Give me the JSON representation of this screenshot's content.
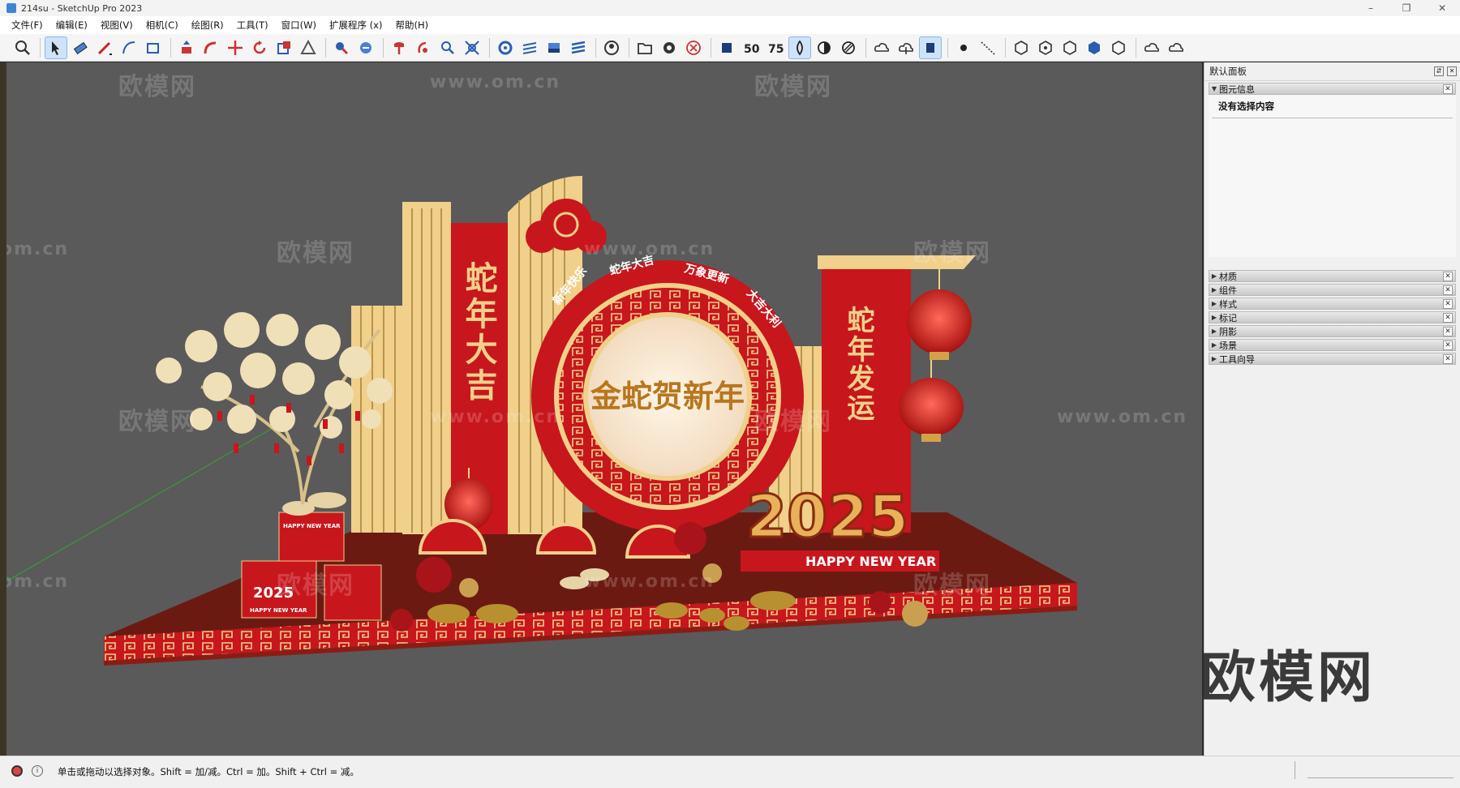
{
  "window": {
    "title": "214su - SketchUp Pro 2023",
    "controls": [
      "–",
      "❐",
      "✕"
    ]
  },
  "menu": {
    "items": [
      "文件(F)",
      "编辑(E)",
      "视图(V)",
      "相机(C)",
      "绘图(R)",
      "工具(T)",
      "窗口(W)",
      "扩展程序 (x)",
      "帮助(H)"
    ]
  },
  "toolbar": {
    "tools": [
      "zoom-icon",
      "select-icon",
      "eraser-icon",
      "pencil-icon",
      "arc-icon",
      "rectangle-icon",
      "pushpull-icon",
      "followme-icon",
      "move-icon",
      "rotate-icon",
      "scale-icon",
      "offset-icon",
      "tape-icon",
      "protractor-icon",
      "section-icon",
      "orbit-icon",
      "pan-icon",
      "zoomext-icon",
      "components-icon",
      "materials-icon",
      "styles-icon",
      "layers-icon",
      "user-icon",
      "open-icon",
      "settings-icon",
      "cancel-icon",
      "warehouse-icon",
      "50-icon",
      "75-icon",
      "xray-icon",
      "mono-icon",
      "hidden-icon",
      "cloud1-icon",
      "cloud2-icon",
      "cloud3-icon",
      "point-icon",
      "dim-icon",
      "view1-icon",
      "view2-icon",
      "view3-icon",
      "view4-icon",
      "view5-icon",
      "sync1-icon",
      "sync2-icon"
    ]
  },
  "tray": {
    "title": "默认面板",
    "entity_info": {
      "label": "图元信息",
      "content": "没有选择内容"
    },
    "panels": [
      "材质",
      "组件",
      "样式",
      "标记",
      "阴影",
      "场景",
      "工具向导"
    ]
  },
  "model": {
    "banner_left": "蛇年大吉",
    "banner_right": "蛇年发运",
    "circle_main": "金蛇贺新年",
    "arc_texts": [
      "新年快乐",
      "蛇年大吉",
      "万象更新",
      "大吉大利"
    ],
    "year": "2025",
    "ribbon": "HAPPY NEW YEAR",
    "box_top": "HAPPY NEW YEAR",
    "box_year": "2025",
    "box_left_bottom": "HAPPY NEW YEAR"
  },
  "watermarks": {
    "text_cn": "欧模网",
    "text_url": "www.om.cn",
    "text_edge": "om.cn",
    "big": "欧模网"
  },
  "status": {
    "text": "单击或拖动以选择对象。Shift = 加/减。Ctrl = 加。Shift + Ctrl = 减。"
  },
  "colors": {
    "viewport_bg": "#5a5a5a",
    "red": "#c8161d",
    "gold": "#f0d08a",
    "floor": "#6b1a12"
  }
}
